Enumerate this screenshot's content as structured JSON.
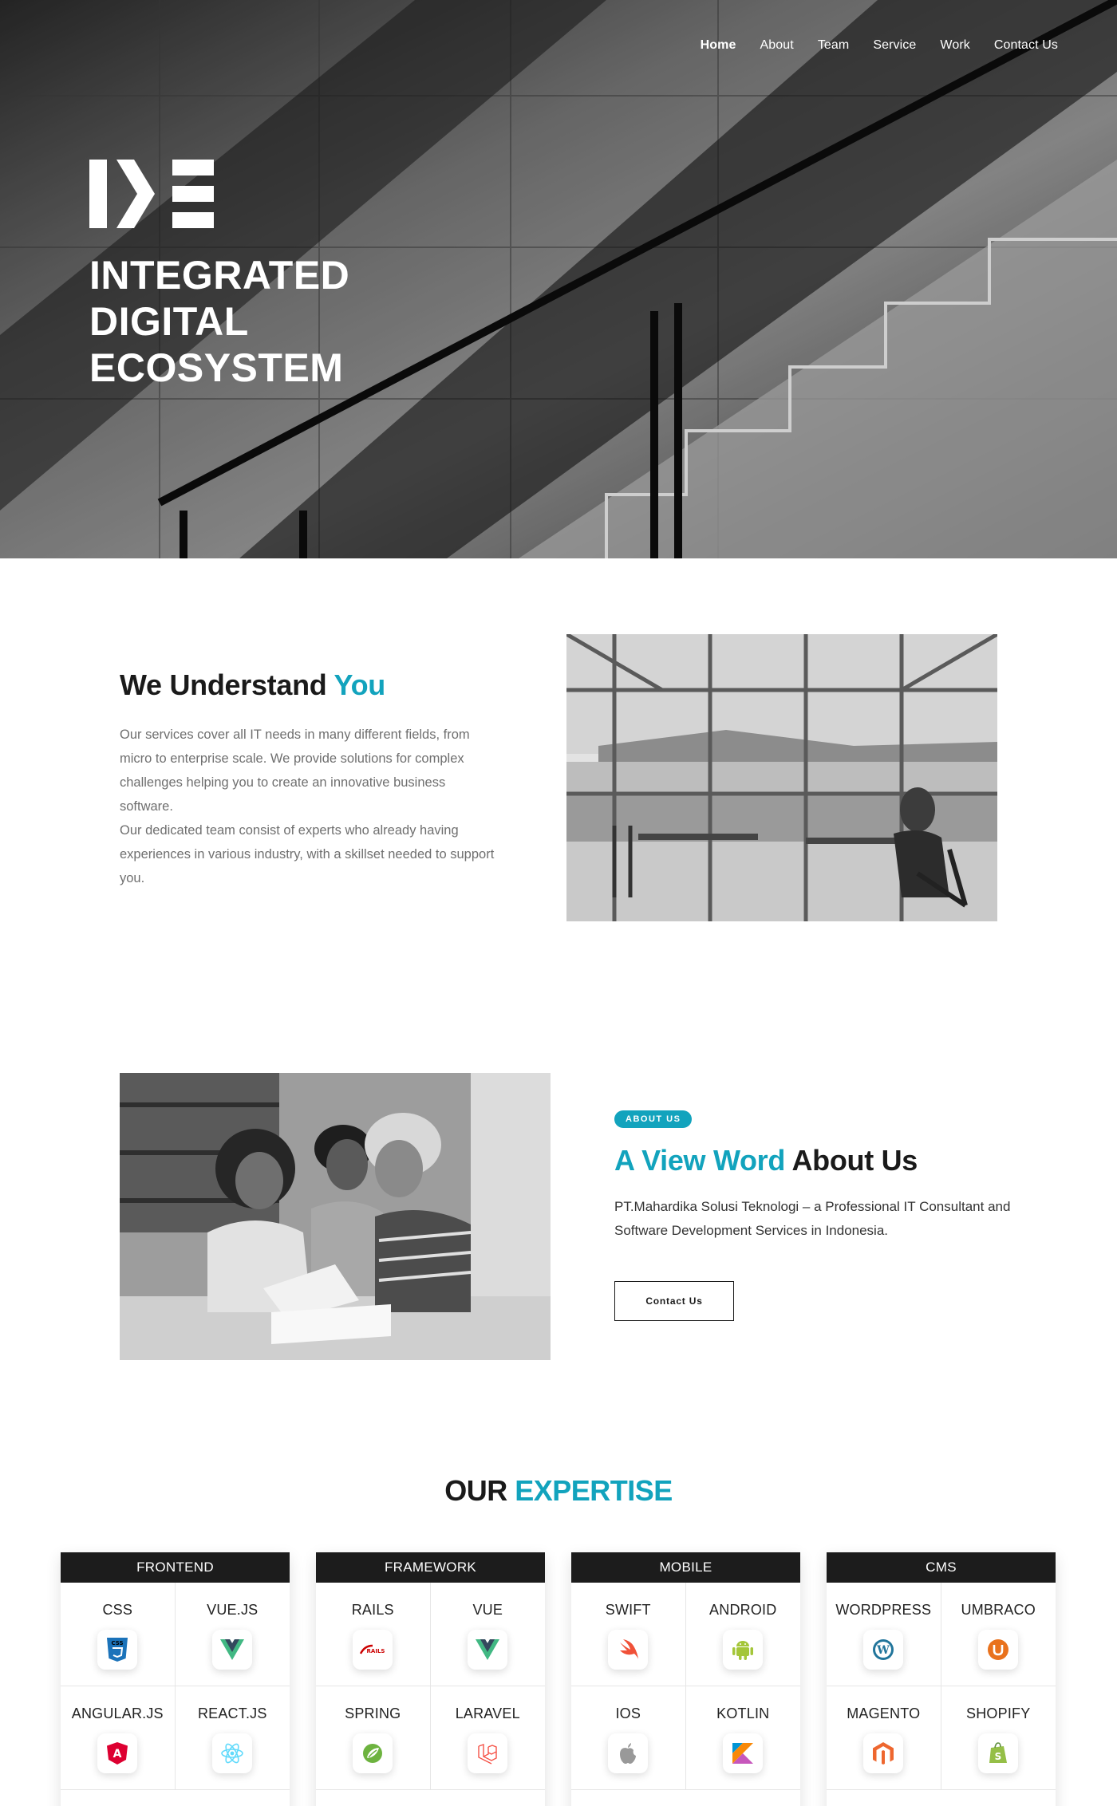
{
  "nav": {
    "items": [
      {
        "label": "Home",
        "active": true
      },
      {
        "label": "About",
        "active": false
      },
      {
        "label": "Team",
        "active": false
      },
      {
        "label": "Service",
        "active": false
      },
      {
        "label": "Work",
        "active": false
      },
      {
        "label": "Contact Us",
        "active": false
      }
    ]
  },
  "hero": {
    "logo_icon": "ide-logo",
    "title_lines": [
      "INTEGRATED",
      "DIGITAL",
      "ECOSYSTEM"
    ]
  },
  "understand": {
    "heading_main": "We Understand",
    "heading_accent": "You",
    "paragraph1": "Our services cover all IT needs in many different fields, from micro to enterprise scale. We provide solutions for complex challenges helping you to create an innovative business software.",
    "paragraph2": "Our dedicated team consist of experts who already having experiences in various industry, with a skillset needed to support you."
  },
  "about": {
    "badge": "ABOUT US",
    "heading_accent": "A View Word",
    "heading_main": "About Us",
    "text": "PT.Mahardika Solusi Teknologi – a Professional IT Consultant and Software Development Services in Indonesia.",
    "button": "Contact Us"
  },
  "expertise": {
    "title_main": "OUR",
    "title_accent": "EXPERTISE",
    "categories": [
      {
        "name": "FRONTEND",
        "items": [
          {
            "name": "CSS",
            "icon": "css3-icon"
          },
          {
            "name": "VUE.JS",
            "icon": "vue-icon"
          },
          {
            "name": "ANGULAR.JS",
            "icon": "angular-icon"
          },
          {
            "name": "REACT.JS",
            "icon": "react-icon"
          }
        ]
      },
      {
        "name": "FRAMEWORK",
        "items": [
          {
            "name": "RAILS",
            "icon": "rails-icon"
          },
          {
            "name": "VUE",
            "icon": "vue-icon"
          },
          {
            "name": "SPRING",
            "icon": "spring-icon"
          },
          {
            "name": "LARAVEL",
            "icon": "laravel-icon"
          }
        ]
      },
      {
        "name": "MOBILE",
        "items": [
          {
            "name": "SWIFT",
            "icon": "swift-icon"
          },
          {
            "name": "ANDROID",
            "icon": "android-icon"
          },
          {
            "name": "IOS",
            "icon": "apple-icon"
          },
          {
            "name": "KOTLIN",
            "icon": "kotlin-icon"
          }
        ]
      },
      {
        "name": "CMS",
        "items": [
          {
            "name": "WORDPRESS",
            "icon": "wordpress-icon"
          },
          {
            "name": "UMBRACO",
            "icon": "umbraco-icon"
          },
          {
            "name": "MAGENTO",
            "icon": "magento-icon"
          },
          {
            "name": "SHOPIFY",
            "icon": "shopify-icon"
          }
        ]
      }
    ]
  },
  "colors": {
    "accent": "#12a3bd",
    "dark": "#1c1c1c",
    "text_muted": "#6f6f6f"
  }
}
